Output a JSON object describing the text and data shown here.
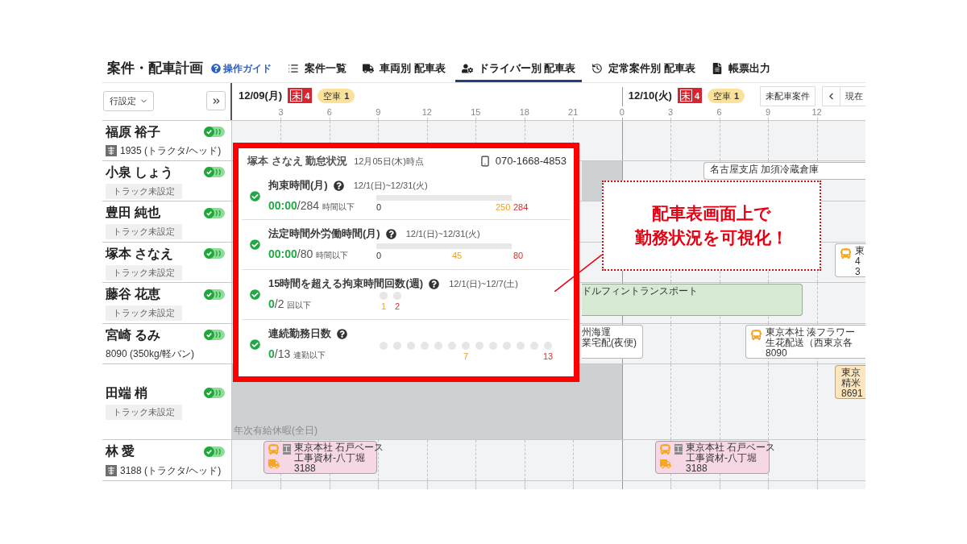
{
  "header": {
    "title": "案件・配車計画",
    "guide": "操作ガイド",
    "tabs": [
      {
        "label": "案件一覧",
        "selected": false
      },
      {
        "label": "車両別 配車表",
        "selected": false
      },
      {
        "label": "ドライバー別 配車表",
        "selected": true
      },
      {
        "label": "定常案件別 配車表",
        "selected": false
      },
      {
        "label": "帳票出力",
        "selected": false
      }
    ]
  },
  "toolbar": {
    "row_settings": "行設定"
  },
  "timeline": {
    "days": [
      {
        "date": "12/09(月)",
        "unassigned": {
          "mark": "未",
          "count": "4"
        },
        "empty_vehicles": {
          "label": "空車",
          "count": "1"
        },
        "hours": [
          "3",
          "6",
          "9",
          "12",
          "15",
          "18",
          "21"
        ]
      },
      {
        "date": "12/10(火)",
        "unassigned": {
          "mark": "未",
          "count": "4"
        },
        "empty_vehicles": {
          "label": "空車",
          "count": "1"
        },
        "hours": [
          "0",
          "3",
          "6",
          "9",
          "12"
        ]
      }
    ],
    "actions": {
      "unassigned_jobs": "未配車案件",
      "now": "現在"
    }
  },
  "drivers": [
    {
      "name": "福原 裕子",
      "on": true,
      "vehicle": {
        "kind": "tagged",
        "text": "1935 (トラクタ/ヘッド)"
      }
    },
    {
      "name": "小泉 しょう",
      "on": true,
      "vehicle": {
        "kind": "unset",
        "text": "トラック未設定"
      },
      "events": [
        {
          "kind": "off"
        },
        {
          "kind": "plain",
          "color": "#ffffff",
          "lines": [
            "名古屋支店 加須冷蔵倉庫"
          ]
        }
      ]
    },
    {
      "name": "豊田 純也",
      "on": true,
      "vehicle": {
        "kind": "unset",
        "text": "トラック未設定"
      }
    },
    {
      "name": "塚本 さなえ",
      "on": true,
      "vehicle": {
        "kind": "unset",
        "text": "トラック未設定"
      },
      "events": [
        {
          "kind": "scheduled",
          "color": "#ffffff",
          "lines": [
            "東",
            "4",
            "3"
          ]
        }
      ]
    },
    {
      "name": "藤谷 花恵",
      "on": true,
      "vehicle": {
        "kind": "unset",
        "text": "トラック未設定"
      },
      "events": [
        {
          "kind": "plain",
          "color": "#d7ebd4",
          "lines": [
            "ドルフィントランスポート"
          ]
        }
      ]
    },
    {
      "name": "宮崎 るみ",
      "on": true,
      "vehicle": {
        "kind": "plain",
        "text": "8090 (350kg/軽バン)"
      },
      "events": [
        {
          "kind": "plain",
          "color": "#ffffff",
          "lines": [
            "州海運",
            "業宅配(夜便)"
          ]
        },
        {
          "kind": "scheduled",
          "color": "#ffffff",
          "lines": [
            "東京本社 湊フラワー",
            "生花配送（西東京各",
            "8090"
          ]
        }
      ]
    },
    {
      "name": "田端 梢",
      "on": true,
      "vehicle": {
        "kind": "unset",
        "text": "トラック未設定"
      },
      "events": [
        {
          "kind": "leave",
          "label": "年次有給休暇(全日)"
        },
        {
          "kind": "plain",
          "color": "#fde6bd",
          "lines": [
            "東京",
            "精米",
            "8691"
          ]
        }
      ]
    },
    {
      "name": "林 愛",
      "on": true,
      "vehicle": {
        "kind": "tagged",
        "text": "3188 (トラクタ/ヘッド)"
      },
      "events": [
        {
          "kind": "assigned",
          "color": "#f6d7e5",
          "tag": "工",
          "lines": [
            "東京本社 石戸ベース",
            "工事資材-八丁堀",
            "3188"
          ]
        },
        {
          "kind": "assigned",
          "color": "#f6d7e5",
          "tag": "工",
          "lines": [
            "東京本社 石戸ベース",
            "工事資材-八丁堀",
            "3188"
          ]
        }
      ]
    }
  ],
  "popup": {
    "title": "塚本 さなえ 勤怠状況",
    "as_of": "12月05日(木)時点",
    "phone": "070-1668-4853",
    "metrics": [
      {
        "kind": "bar",
        "within_limit": true,
        "title": "拘束時間(月)",
        "period": "12/1(日)~12/31(火)",
        "value": "00:00",
        "limit": "/284",
        "unit": "時間以下",
        "level": 0,
        "ticks": [
          {
            "label": "0",
            "kind": "start"
          },
          {
            "label": "250",
            "kind": "warn"
          },
          {
            "label": "284",
            "kind": "limit"
          }
        ]
      },
      {
        "kind": "bar",
        "within_limit": true,
        "title": "法定時間外労働時間(月)",
        "period": "12/1(日)~12/31(火)",
        "value": "00:00",
        "limit": "/80",
        "unit": "時間以下",
        "level": 0,
        "ticks": [
          {
            "label": "0",
            "kind": "start"
          },
          {
            "label": "45",
            "kind": "warn"
          },
          {
            "label": "80",
            "kind": "limit"
          }
        ]
      },
      {
        "kind": "dots",
        "within_limit": true,
        "title": "15時間を超える拘束時間回数(週)",
        "period": "12/1(日)~12/7(土)",
        "value": "0",
        "limit": "/2",
        "unit": "回以下",
        "dots": [
          {
            "filled": false,
            "label": "1",
            "kind": "warn"
          },
          {
            "filled": false,
            "label": "2",
            "kind": "limit"
          }
        ]
      },
      {
        "kind": "dots",
        "within_limit": true,
        "title": "連続勤務日数",
        "value": "0",
        "limit": "/13",
        "unit": "連勤以下",
        "dots": [
          {
            "filled": false
          },
          {
            "filled": false
          },
          {
            "filled": false
          },
          {
            "filled": false
          },
          {
            "filled": false
          },
          {
            "filled": false
          },
          {
            "filled": false,
            "label": "7",
            "kind": "warn"
          },
          {
            "filled": false
          },
          {
            "filled": false
          },
          {
            "filled": false
          },
          {
            "filled": false
          },
          {
            "filled": false
          },
          {
            "filled": false,
            "label": "13",
            "kind": "limit"
          }
        ]
      }
    ]
  },
  "callout": {
    "lines": [
      "配車表画面上で",
      "勤務状況を可視化！"
    ]
  }
}
